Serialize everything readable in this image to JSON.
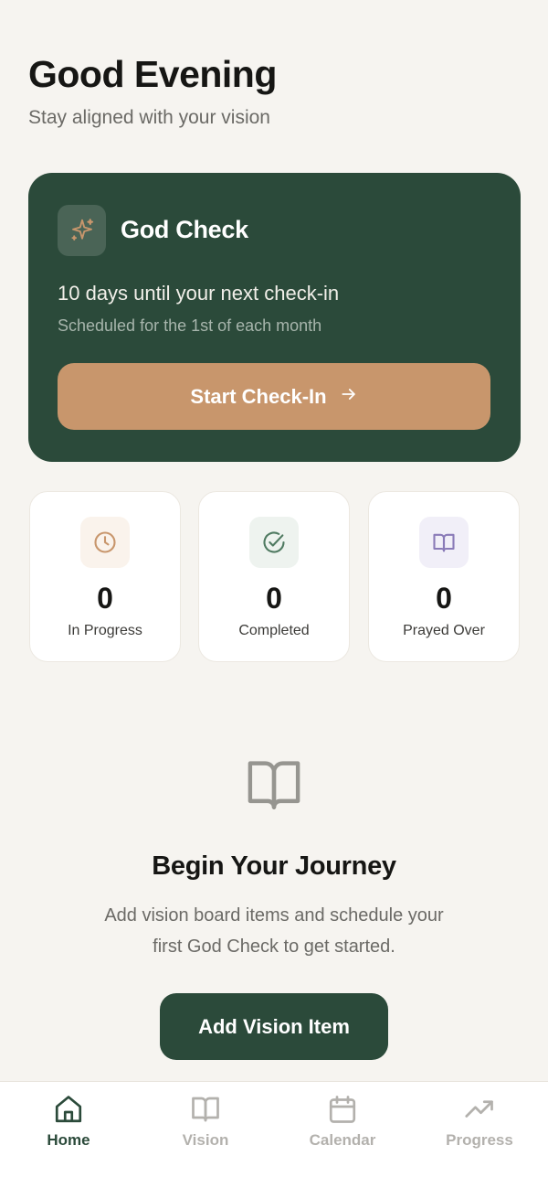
{
  "header": {
    "greeting": "Good Evening",
    "subtitle": "Stay aligned with your vision"
  },
  "god_check": {
    "icon": "sparkle-icon",
    "title": "God Check",
    "days_until": "10 days until your next check-in",
    "schedule": "Scheduled for the 1st of each month",
    "button_label": "Start Check-In",
    "button_icon": "arrow-right-icon"
  },
  "stats": [
    {
      "icon": "clock-icon",
      "value": "0",
      "label": "In Progress",
      "accent": "#c8966c"
    },
    {
      "icon": "check-circle-icon",
      "value": "0",
      "label": "Completed",
      "accent": "#4f7a61"
    },
    {
      "icon": "book-icon",
      "value": "0",
      "label": "Prayed Over",
      "accent": "#8a7bb8"
    }
  ],
  "empty_state": {
    "icon": "open-book-icon",
    "title": "Begin Your Journey",
    "line1": "Add vision board items and schedule your",
    "line2": "first God Check to get started.",
    "button_label": "Add Vision Item"
  },
  "tabbar": {
    "items": [
      {
        "label": "Home",
        "icon": "home-icon",
        "active": true
      },
      {
        "label": "Vision",
        "icon": "book-icon",
        "active": false
      },
      {
        "label": "Calendar",
        "icon": "calendar-icon",
        "active": false
      },
      {
        "label": "Progress",
        "icon": "trending-up-icon",
        "active": false
      }
    ]
  },
  "colors": {
    "primary": "#2b4a3a",
    "accent": "#c8966c",
    "background": "#f6f4f0"
  }
}
